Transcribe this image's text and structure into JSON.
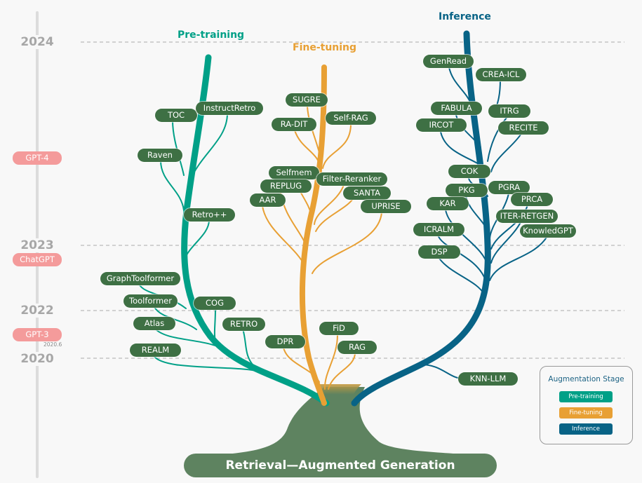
{
  "title": "Retrieval—Augmented Generation",
  "colors": {
    "pretraining": "#00a087",
    "finetuning": "#e8a034",
    "inference": "#086386",
    "node": "#3e7044",
    "trunk": "#5e8360",
    "milestone": "#f49b9b",
    "timeline": "#dcdcdc"
  },
  "timeline": {
    "years": [
      "2024",
      "2023",
      "2022",
      "2020"
    ],
    "milestones": [
      {
        "label": "GPT-4",
        "note": ""
      },
      {
        "label": "ChatGPT",
        "note": ""
      },
      {
        "label": "GPT-3",
        "note": "2020.6"
      }
    ]
  },
  "stages": {
    "pretraining": {
      "title": "Pre-training",
      "nodes": [
        "TOC",
        "InstructRetro",
        "Raven",
        "Retro++",
        "GraphToolformer",
        "Toolformer",
        "COG",
        "Atlas",
        "RETRO",
        "REALM"
      ]
    },
    "finetuning": {
      "title": "Fine-tuning",
      "nodes": [
        "SUGRE",
        "RA-DIT",
        "Self-RAG",
        "Selfmem",
        "Filter-Reranker",
        "REPLUG",
        "SANTA",
        "AAR",
        "UPRISE",
        "FiD",
        "DPR",
        "RAG"
      ]
    },
    "inference": {
      "title": "Inference",
      "nodes": [
        "GenRead",
        "CREA-ICL",
        "FABULA",
        "ITRG",
        "IRCOT",
        "RECITE",
        "COK",
        "PKG",
        "PGRA",
        "PRCA",
        "KAR",
        "ITER-RETGEN",
        "KnowledGPT",
        "ICRALM",
        "DSP",
        "KNN-LLM"
      ]
    }
  },
  "legend": {
    "title": "Augmentation Stage",
    "items": [
      "Pre-training",
      "Fine-tuning",
      "Inference"
    ]
  }
}
